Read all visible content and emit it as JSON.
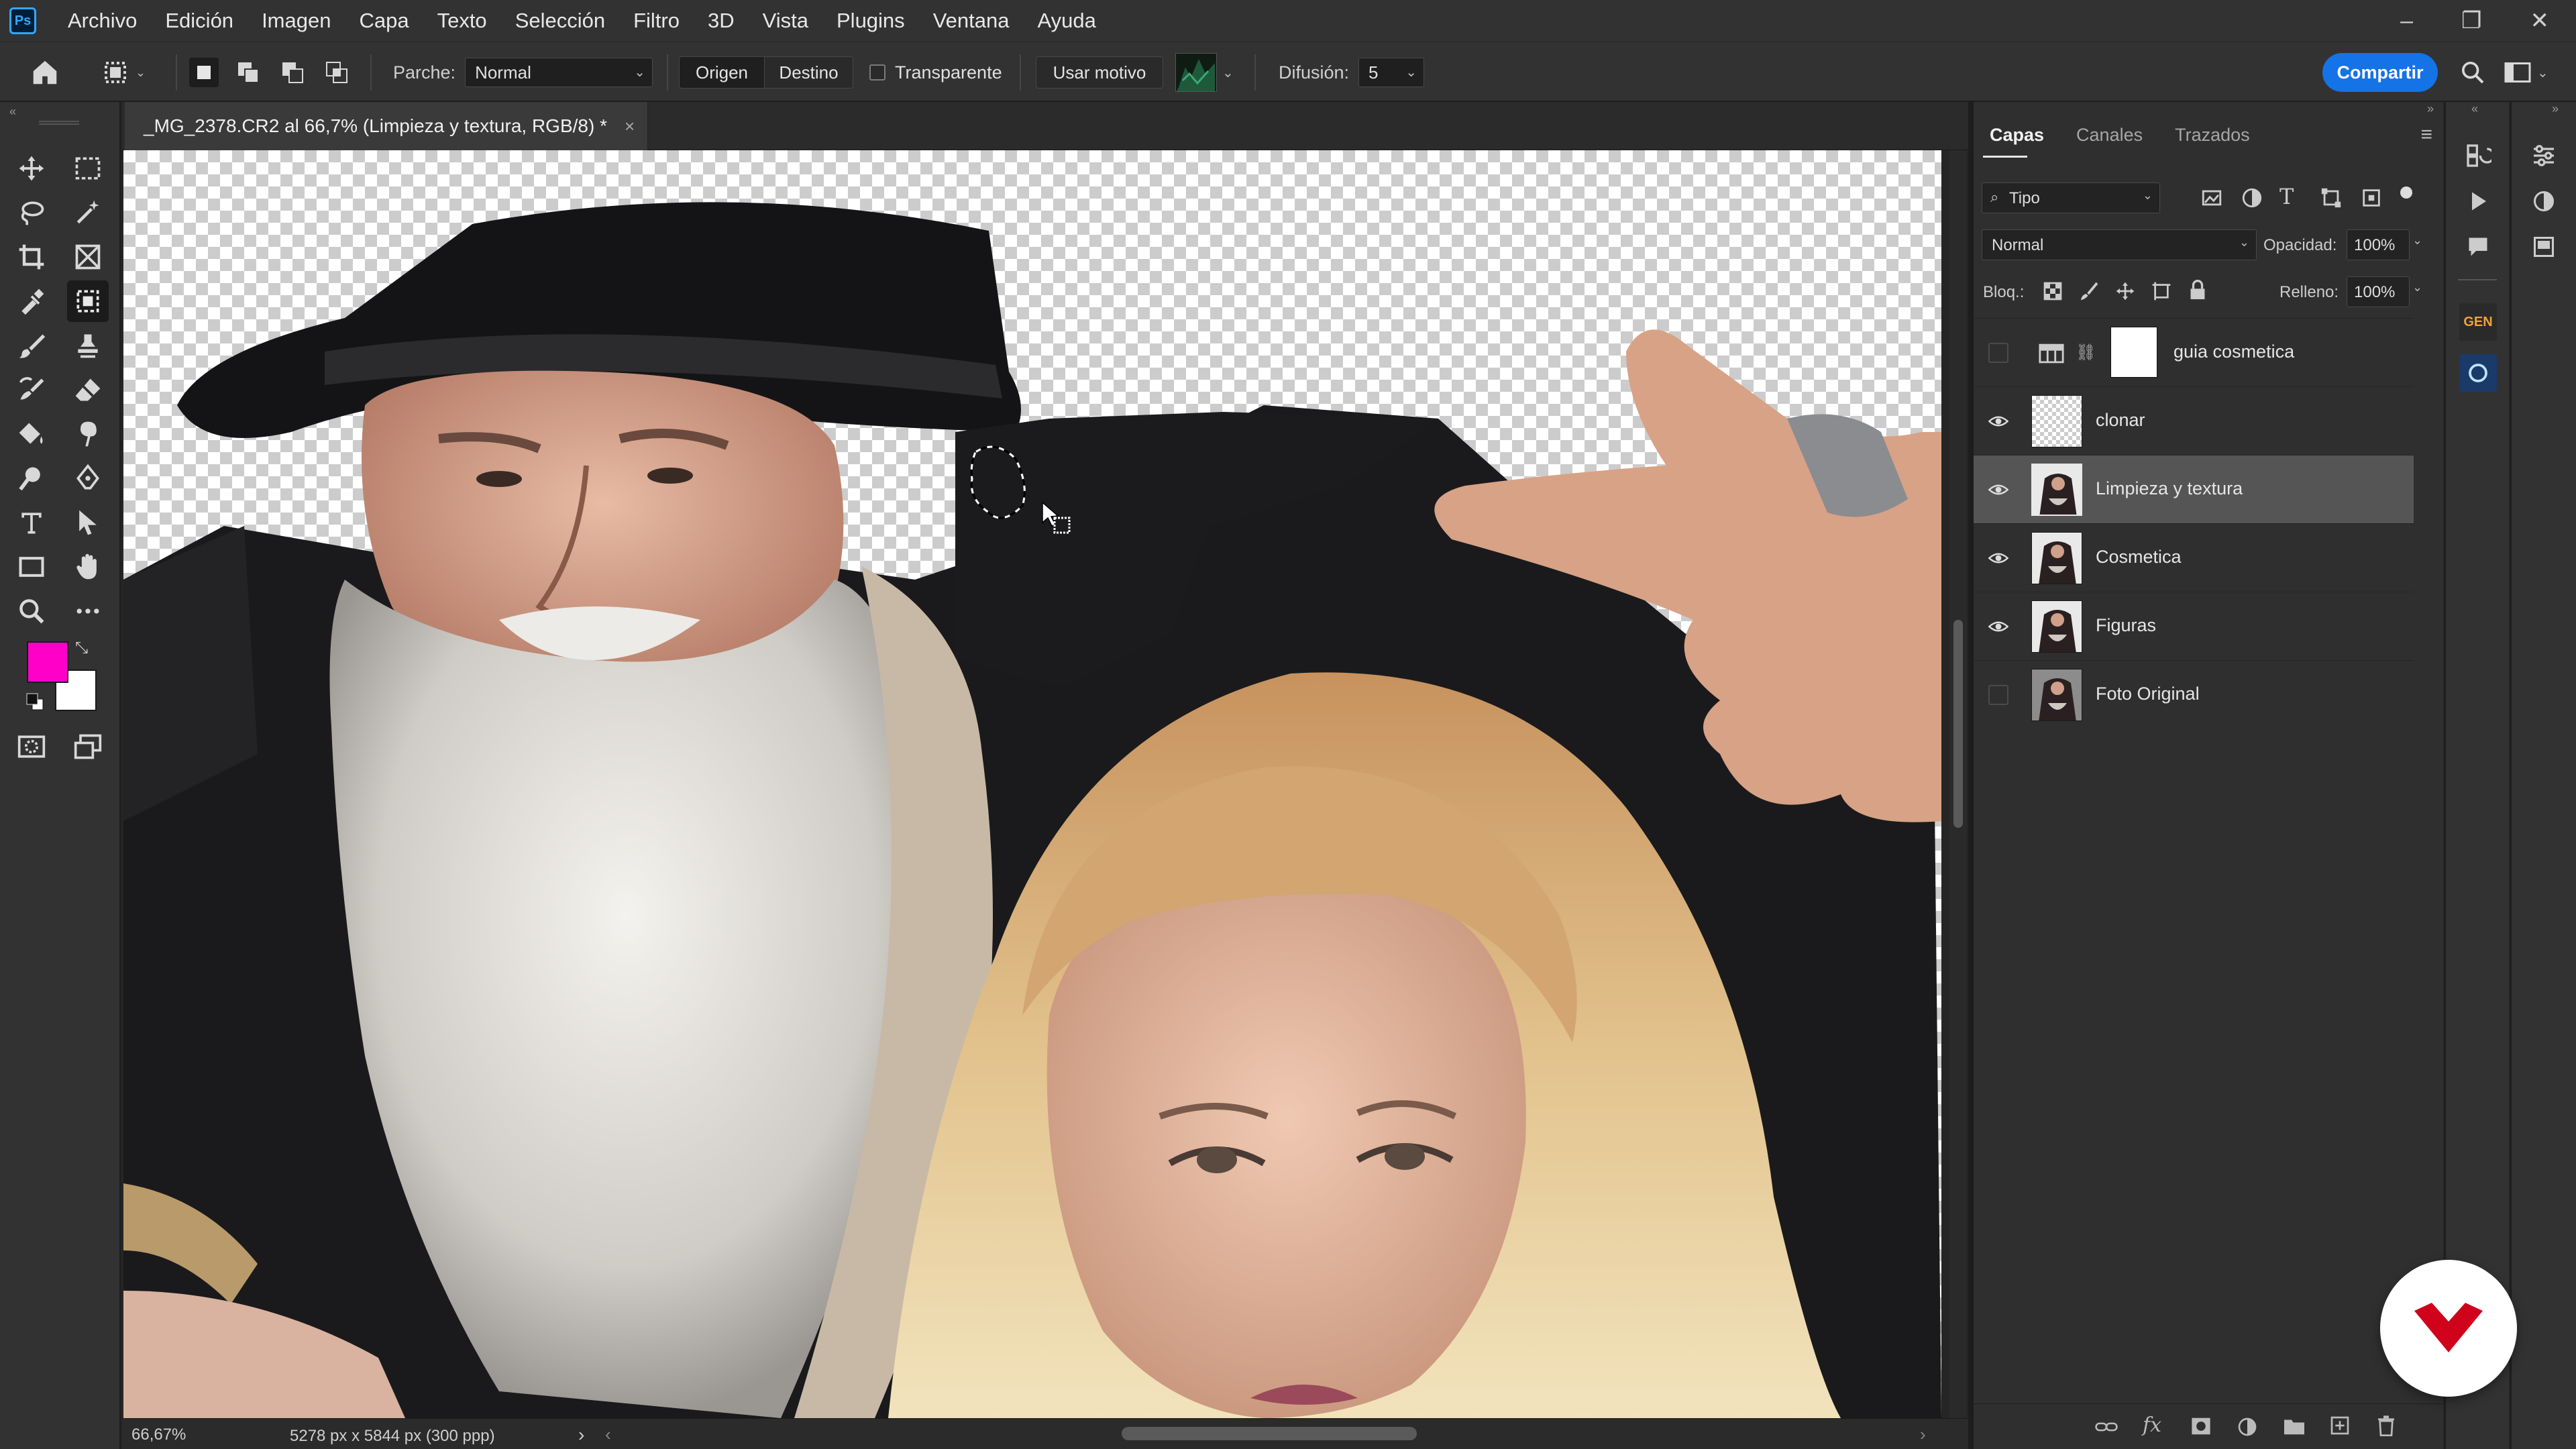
{
  "app": {
    "logo_text": "Ps"
  },
  "menu": [
    "Archivo",
    "Edición",
    "Imagen",
    "Capa",
    "Texto",
    "Selección",
    "Filtro",
    "3D",
    "Vista",
    "Plugins",
    "Ventana",
    "Ayuda"
  ],
  "window_controls": {
    "minimize": "–",
    "restore": "❐",
    "close": "✕"
  },
  "options_bar": {
    "patch_label": "Parche:",
    "patch_mode": "Normal",
    "source_label": "Origen",
    "destination_label": "Destino",
    "transparent_label": "Transparente",
    "use_pattern_label": "Usar motivo",
    "diffusion_label": "Difusión:",
    "diffusion_value": "5",
    "share_label": "Compartir"
  },
  "document": {
    "tab_title": "_MG_2378.CR2 al 66,7% (Limpieza y textura, RGB/8) *",
    "close_glyph": "×"
  },
  "status": {
    "zoom": "66,67%",
    "doc_size": "5278 px x 5844 px (300 ppp)",
    "arrow": "›"
  },
  "colors": {
    "foreground": "#ff00c8",
    "background": "#ffffff",
    "accent": "#1473e6",
    "badge_red": "#d0021b"
  },
  "layers_panel": {
    "tabs": [
      "Capas",
      "Canales",
      "Trazados"
    ],
    "filter_label": "Tipo",
    "blend_mode": "Normal",
    "opacity_label": "Opacidad:",
    "opacity_value": "100%",
    "lock_label": "Bloq.:",
    "fill_label": "Relleno:",
    "fill_value": "100%",
    "layers": [
      {
        "name": "guia cosmetica",
        "visible": false,
        "type": "adjustment"
      },
      {
        "name": "clonar",
        "visible": true,
        "type": "empty"
      },
      {
        "name": "Limpieza y textura",
        "visible": true,
        "type": "photo",
        "selected": true
      },
      {
        "name": "Cosmetica",
        "visible": true,
        "type": "photo"
      },
      {
        "name": "Figuras",
        "visible": true,
        "type": "photo"
      },
      {
        "name": "Foto Original",
        "visible": false,
        "type": "photo"
      }
    ]
  },
  "icons": {
    "dock_gen_label": "GEN"
  }
}
